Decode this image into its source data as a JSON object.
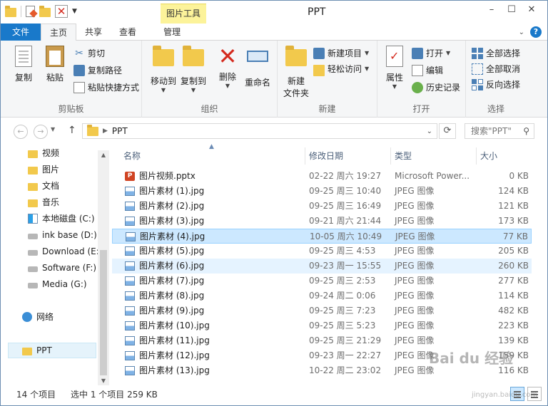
{
  "window": {
    "title": "PPT",
    "context_tab": "图片工具",
    "controls": [
      "–",
      "☐",
      "✕"
    ]
  },
  "ribbon_tabs": {
    "file": "文件",
    "home": "主页",
    "share": "共享",
    "view": "查看",
    "manage": "管理"
  },
  "ribbon": {
    "clipboard": {
      "label": "剪贴板",
      "copy": "复制",
      "paste": "粘贴",
      "cut": "剪切",
      "copy_path": "复制路径",
      "paste_shortcut": "粘贴快捷方式"
    },
    "organize": {
      "label": "组织",
      "move_to": "移动到",
      "copy_to": "复制到",
      "delete": "删除",
      "rename": "重命名"
    },
    "new": {
      "label": "新建",
      "new_folder_line1": "新建",
      "new_folder_line2": "文件夹",
      "new_item": "新建项目",
      "easy_access": "轻松访问"
    },
    "open": {
      "label": "打开",
      "properties": "属性",
      "open": "打开",
      "edit": "编辑",
      "history": "历史记录"
    },
    "select": {
      "label": "选择",
      "select_all": "全部选择",
      "select_none": "全部取消",
      "invert": "反向选择"
    }
  },
  "address": {
    "path": "PPT",
    "search_placeholder": "搜索\"PPT\""
  },
  "nav": {
    "items": [
      {
        "label": "视频",
        "icon": "folder"
      },
      {
        "label": "图片",
        "icon": "folder"
      },
      {
        "label": "文档",
        "icon": "folder"
      },
      {
        "label": "音乐",
        "icon": "folder"
      },
      {
        "label": "本地磁盘 (C:)",
        "icon": "win"
      },
      {
        "label": "ink base (D:)",
        "icon": "drive"
      },
      {
        "label": "Download (E:",
        "icon": "drive"
      },
      {
        "label": "Software (F:)",
        "icon": "drive"
      },
      {
        "label": "Media (G:)",
        "icon": "drive"
      }
    ],
    "network": "网络",
    "current": "PPT"
  },
  "columns": {
    "name": "名称",
    "date": "修改日期",
    "type": "类型",
    "size": "大小"
  },
  "files": [
    {
      "name": "图片视频.pptx",
      "date": "02-22 周六 19:27",
      "type": "Microsoft Power...",
      "size": "0 KB",
      "icon": "ppt"
    },
    {
      "name": "图片素材 (1).jpg",
      "date": "09-25 周三 10:40",
      "type": "JPEG 图像",
      "size": "124 KB",
      "icon": "img"
    },
    {
      "name": "图片素材 (2).jpg",
      "date": "09-25 周三 16:49",
      "type": "JPEG 图像",
      "size": "121 KB",
      "icon": "img"
    },
    {
      "name": "图片素材 (3).jpg",
      "date": "09-21 周六 21:44",
      "type": "JPEG 图像",
      "size": "173 KB",
      "icon": "img"
    },
    {
      "name": "图片素材 (4).jpg",
      "date": "10-05 周六 10:49",
      "type": "JPEG 图像",
      "size": "77 KB",
      "icon": "img"
    },
    {
      "name": "图片素材 (5).jpg",
      "date": "09-25 周三 4:53",
      "type": "JPEG 图像",
      "size": "205 KB",
      "icon": "img"
    },
    {
      "name": "图片素材 (6).jpg",
      "date": "09-23 周一 15:55",
      "type": "JPEG 图像",
      "size": "260 KB",
      "icon": "img"
    },
    {
      "name": "图片素材 (7).jpg",
      "date": "09-25 周三 2:53",
      "type": "JPEG 图像",
      "size": "277 KB",
      "icon": "img"
    },
    {
      "name": "图片素材 (8).jpg",
      "date": "09-24 周二 0:06",
      "type": "JPEG 图像",
      "size": "114 KB",
      "icon": "img"
    },
    {
      "name": "图片素材 (9).jpg",
      "date": "09-25 周三 7:23",
      "type": "JPEG 图像",
      "size": "482 KB",
      "icon": "img"
    },
    {
      "name": "图片素材 (10).jpg",
      "date": "09-25 周三 5:23",
      "type": "JPEG 图像",
      "size": "223 KB",
      "icon": "img"
    },
    {
      "name": "图片素材 (11).jpg",
      "date": "09-25 周三 21:29",
      "type": "JPEG 图像",
      "size": "139 KB",
      "icon": "img"
    },
    {
      "name": "图片素材 (12).jpg",
      "date": "09-23 周一 22:27",
      "type": "JPEG 图像",
      "size": "159 KB",
      "icon": "img"
    },
    {
      "name": "图片素材 (13).jpg",
      "date": "10-22 周二 23:02",
      "type": "JPEG 图像",
      "size": "116 KB",
      "icon": "img"
    }
  ],
  "status": {
    "count": "14 个项目",
    "selected": "选中 1 个项目  259 KB"
  },
  "watermark": {
    "main": "Bai du 经验",
    "sub": "jingyan.baidu.com"
  },
  "colors": {
    "file_tab": "#1979ca",
    "context_tab": "#fcf39a",
    "selection": "#cce8ff"
  }
}
